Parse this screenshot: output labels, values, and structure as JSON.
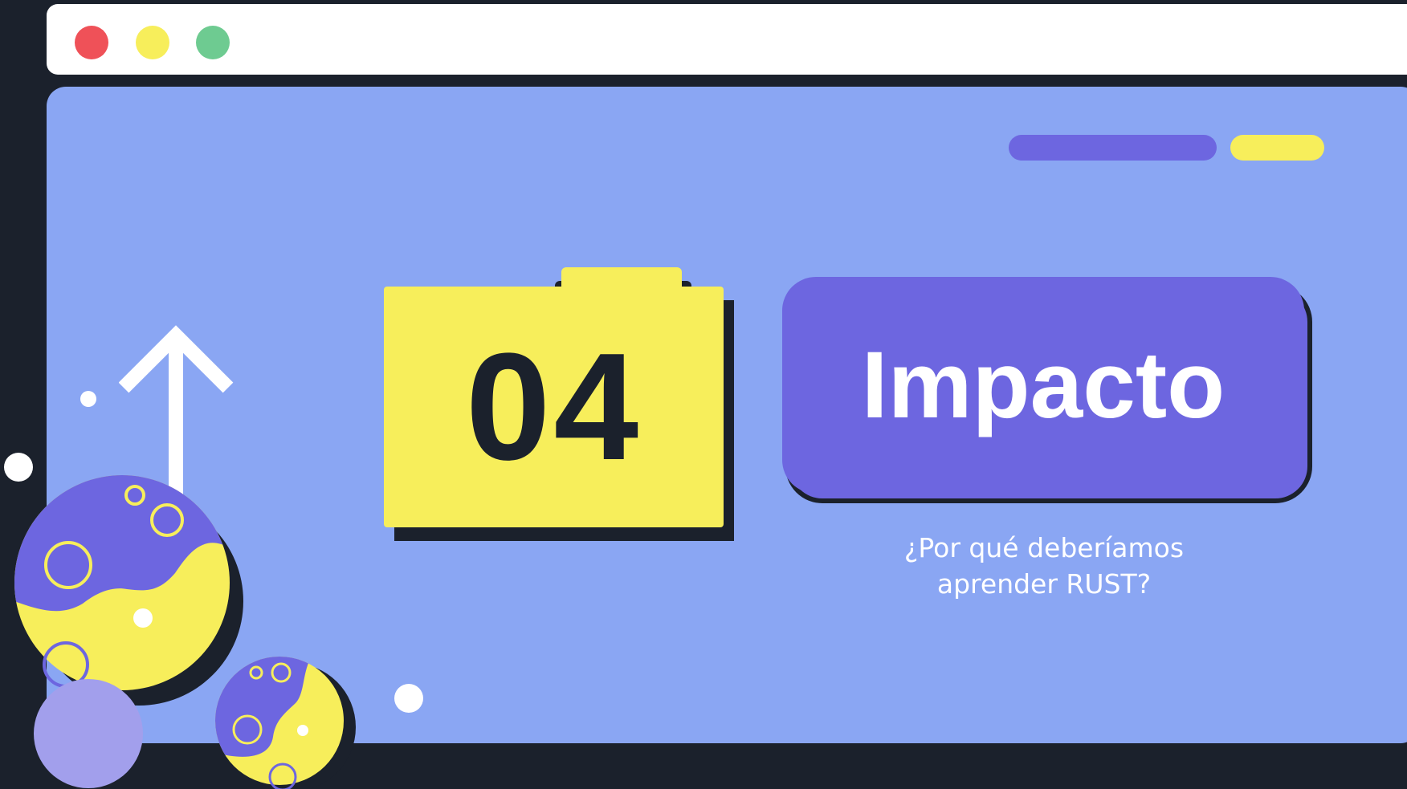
{
  "window": {
    "controls": [
      "close-dot",
      "minimize-dot",
      "maximize-dot"
    ]
  },
  "section": {
    "number": "04",
    "title": "Impacto",
    "subtitle": "¿Por qué deberíamos\naprender RUST?"
  },
  "colors": {
    "background": "#1b212c",
    "panel": "#8aa6f3",
    "accent_purple": "#6d66e0",
    "accent_yellow": "#f7ee5b",
    "dot_red": "#ef5158",
    "dot_yellow": "#f7ee5b",
    "dot_green": "#6ecb91",
    "lavender": "#a29fec"
  },
  "icons": [
    "up-arrow-icon",
    "planet-icon"
  ]
}
